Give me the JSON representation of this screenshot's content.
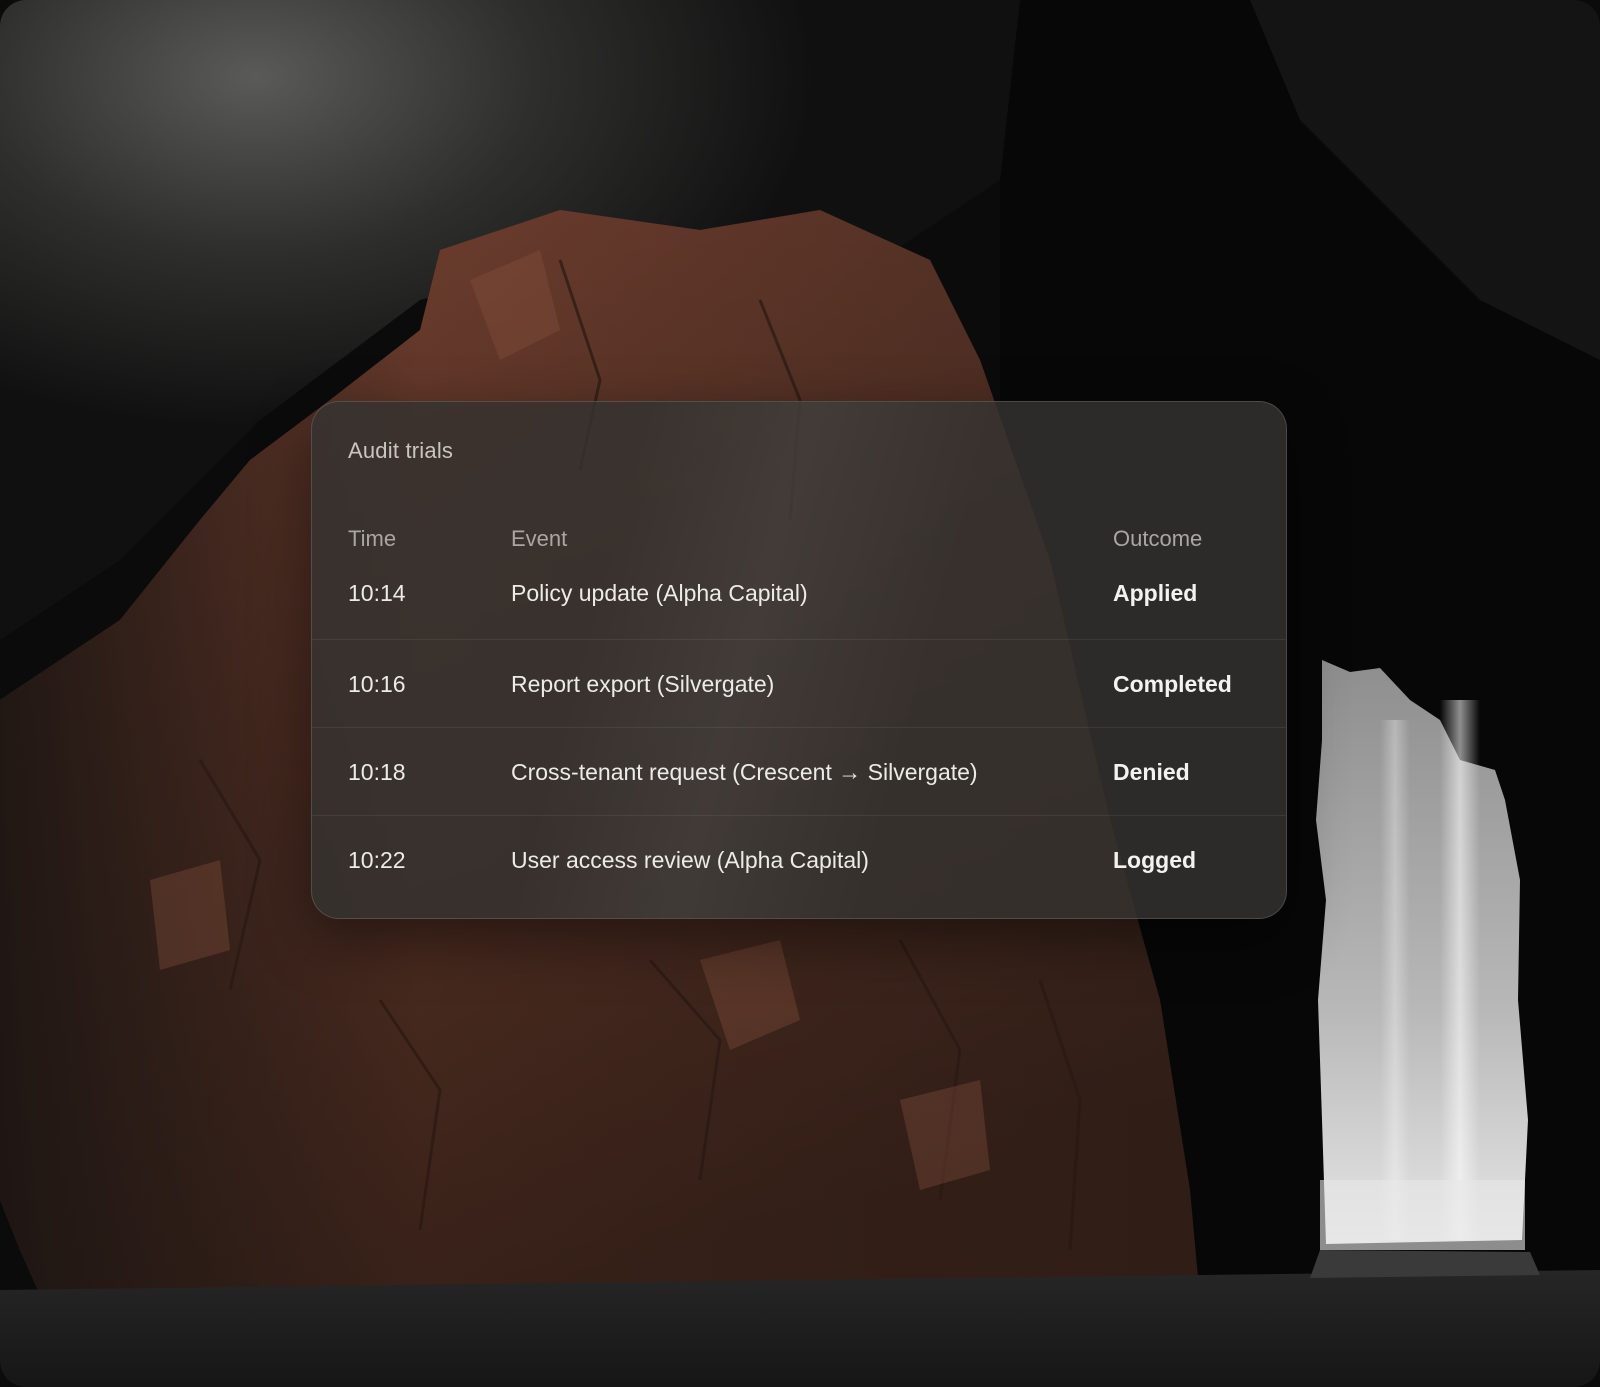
{
  "panel": {
    "title": "Audit trials",
    "columns": {
      "time": "Time",
      "event": "Event",
      "outcome": "Outcome"
    },
    "rows": [
      {
        "time": "10:14",
        "event": "Policy update (Alpha Capital)",
        "outcome": "Applied"
      },
      {
        "time": "10:16",
        "event": "Report export (Silvergate)",
        "outcome": "Completed"
      },
      {
        "time": "10:18",
        "event": "Cross-tenant request (Crescent → Silvergate)",
        "outcome": "Denied"
      },
      {
        "time": "10:22",
        "event": "User access review (Alpha Capital)",
        "outcome": "Logged"
      }
    ]
  },
  "colors": {
    "panel_background": "#343230",
    "rock_accent": "#6b3b2a",
    "waterfall": "#bdbdbd"
  }
}
